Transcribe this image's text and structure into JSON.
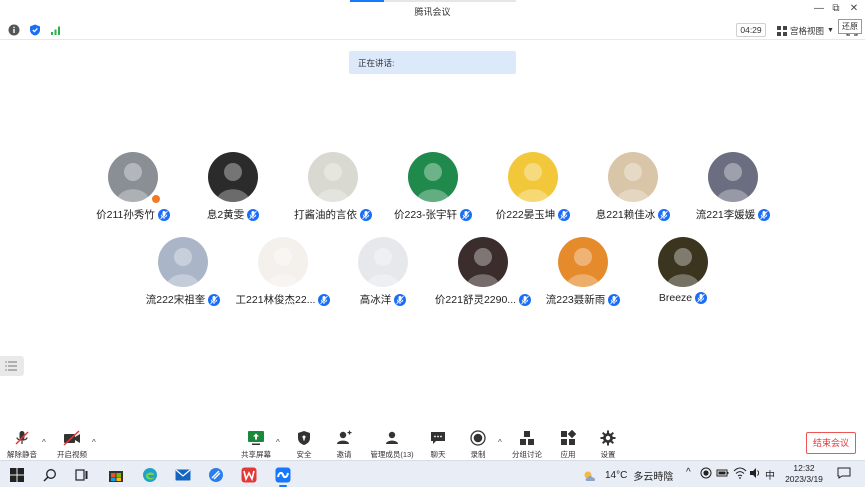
{
  "window": {
    "title": "腾讯会议",
    "restore_tooltip": "还原",
    "minimize_glyph": "—",
    "restore_glyph": "⧉",
    "close_glyph": "✕"
  },
  "infobar": {
    "timer": "04:29",
    "view_label": "宫格视图",
    "icons": [
      "info-icon",
      "shield-icon",
      "signal-icon"
    ]
  },
  "speaking_label": "正在讲话:",
  "participants": [
    {
      "name": "价211孙秀竹",
      "avatar_color": "#8a8f96",
      "host": true
    },
    {
      "name": "息2黄雯",
      "avatar_color": "#2b2b2b",
      "host": false
    },
    {
      "name": "打酱油的言依",
      "avatar_color": "#d9d9d2",
      "host": false
    },
    {
      "name": "价223-张宇轩",
      "avatar_color": "#1f8a4c",
      "host": false
    },
    {
      "name": "价222晏玉坤",
      "avatar_color": "#f2c83a",
      "host": false
    },
    {
      "name": "息221赖佳冰",
      "avatar_color": "#d9c6a8",
      "host": false
    },
    {
      "name": "流221李媛媛",
      "avatar_color": "#6b6e80",
      "host": false
    },
    {
      "name": "流222宋祖奎",
      "avatar_color": "#aab6c8",
      "host": false
    },
    {
      "name": "工221林俊杰22...",
      "avatar_color": "#f4f1ec",
      "host": false
    },
    {
      "name": "高冰洋",
      "avatar_color": "#e7e8ec",
      "host": false
    },
    {
      "name": "价221舒灵2290...",
      "avatar_color": "#3a2d2b",
      "host": false
    },
    {
      "name": "流223聂新雨",
      "avatar_color": "#e58b2c",
      "host": false
    },
    {
      "name": "Breeze",
      "avatar_color": "#3b3520",
      "host": false
    }
  ],
  "toolbar": {
    "unmute": "解除静音",
    "video": "开启视频",
    "share": "共享屏幕",
    "security": "安全",
    "invite": "邀请",
    "members": "管理成员(13)",
    "chat": "聊天",
    "record": "录制",
    "breakout": "分组讨论",
    "apps": "应用",
    "settings": "设置",
    "end": "结束会议",
    "caret": "^"
  },
  "taskbar": {
    "weather_temp": "14°C",
    "weather_text": "多云時陰",
    "caret_glyph": "^",
    "ime": "中",
    "time": "12:32",
    "date": "2023/3/19",
    "icons": [
      "windows-start-icon",
      "search-icon",
      "task-view-icon",
      "store-icon",
      "edge-icon",
      "mail-icon",
      "browser-icon",
      "wps-icon",
      "tencent-meeting-icon"
    ]
  },
  "colors": {
    "accent": "#1677ff",
    "speaking_bg": "#dce9fb",
    "end_red": "#e33333"
  }
}
